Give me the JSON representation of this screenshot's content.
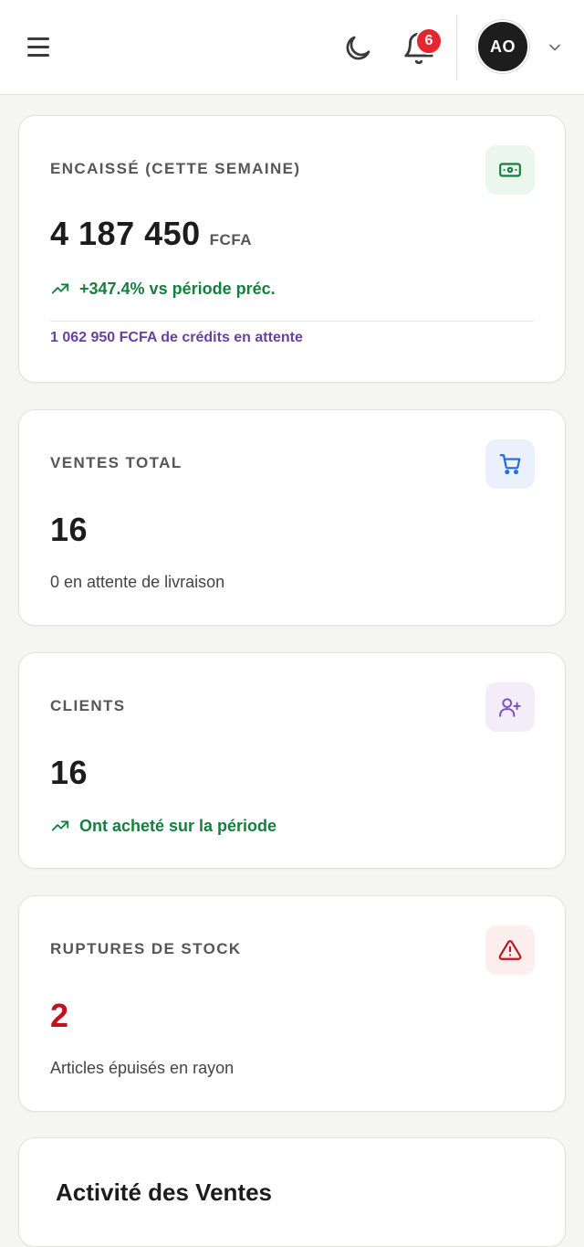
{
  "header": {
    "notification_count": "6",
    "avatar_initials": "AO"
  },
  "cards": [
    {
      "label": "ENCAISSÉ (CETTE SEMAINE)",
      "value": "4 187 450",
      "unit": "FCFA",
      "trend": "+347.4% vs période préc.",
      "footnote": "1 062 950 FCFA de crédits en attente",
      "icon": "banknote-icon",
      "icon_color": "#15803d",
      "icon_bg": "#eaf6ee"
    },
    {
      "label": "VENTES TOTAL",
      "value": "16",
      "sub": "0 en attente de livraison",
      "icon": "shopping-cart-icon",
      "icon_color": "#2563eb",
      "icon_bg": "#eaf1fd"
    },
    {
      "label": "CLIENTS",
      "value": "16",
      "trend": "Ont acheté sur la période",
      "icon": "user-plus-icon",
      "icon_color": "#7c4dbb",
      "icon_bg": "#f2edf9"
    },
    {
      "label": "RUPTURES DE STOCK",
      "value": "2",
      "value_color": "#c1121f",
      "sub": "Articles épuisés en rayon",
      "icon": "alert-triangle-icon",
      "icon_color": "#c1121f",
      "icon_bg": "#fdeeee"
    }
  ],
  "activity": {
    "title": "Activité des Ventes"
  },
  "colors": {
    "positive": "#15803d",
    "credit": "#6b3fa0",
    "badge": "#e3262f"
  }
}
